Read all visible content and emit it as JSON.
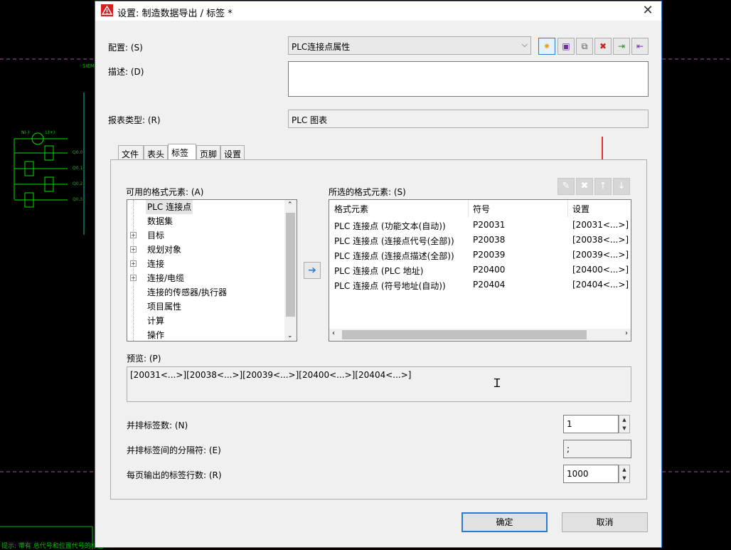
{
  "window": {
    "title": "设置: 制造数据导出 / 标签 *",
    "close": "✕"
  },
  "background": {
    "siemens_label": "SIEM",
    "status_text": "提示: 带有 总代号和位置代号的标签",
    "io_labels": [
      "Q0.0",
      "Q0.1",
      "Q0.2",
      "Q0.3"
    ],
    "symbols": [
      "N(-)",
      "L(+)"
    ]
  },
  "config": {
    "label": "配置: (S)",
    "value": "PLC连接点属性"
  },
  "description": {
    "label": "描述: (D)",
    "value": ""
  },
  "report_type": {
    "label": "报表类型: (R)",
    "value": "PLC 图表"
  },
  "tabs": [
    {
      "label": "文件"
    },
    {
      "label": "表头"
    },
    {
      "label": "标签"
    },
    {
      "label": "页脚"
    },
    {
      "label": "设置"
    }
  ],
  "available": {
    "label": "可用的格式元素: (A)",
    "items": [
      {
        "label": "PLC 连接点",
        "expandable": false
      },
      {
        "label": "数据集",
        "expandable": false
      },
      {
        "label": "目标",
        "expandable": true
      },
      {
        "label": "规划对象",
        "expandable": true
      },
      {
        "label": "连接",
        "expandable": true
      },
      {
        "label": "连接/电缆",
        "expandable": true
      },
      {
        "label": "连接的传感器/执行器",
        "expandable": false
      },
      {
        "label": "项目属性",
        "expandable": false
      },
      {
        "label": "计算",
        "expandable": false
      },
      {
        "label": "操作",
        "expandable": false
      }
    ]
  },
  "selected": {
    "label": "所选的格式元素: (S)",
    "columns": [
      "格式元素",
      "符号",
      "设置"
    ],
    "rows": [
      [
        "PLC 连接点 (功能文本(自动))",
        "P20031",
        "[20031<...>]"
      ],
      [
        "PLC 连接点 (连接点代号(全部))",
        "P20038",
        "[20038<...>]"
      ],
      [
        "PLC 连接点 (连接点描述(全部))",
        "P20039",
        "[20039<...>]"
      ],
      [
        "PLC 连接点 (PLC 地址)",
        "P20400",
        "[20400<...>]"
      ],
      [
        "PLC 连接点 (符号地址(自动))",
        "P20404",
        "[20404<...>]"
      ]
    ]
  },
  "preview": {
    "label": "预览: (P)",
    "value": "[20031<...>][20038<...>][20039<...>][20400<...>][20404<...>]"
  },
  "labels_side_by_side": {
    "label": "并排标签数: (N)",
    "value": "1"
  },
  "separator": {
    "label": "并排标签间的分隔符: (E)",
    "value": ";"
  },
  "rows_per_page": {
    "label": "每页输出的标签行数: (R)",
    "value": "1000"
  },
  "buttons": {
    "ok": "确定",
    "cancel": "取消"
  }
}
